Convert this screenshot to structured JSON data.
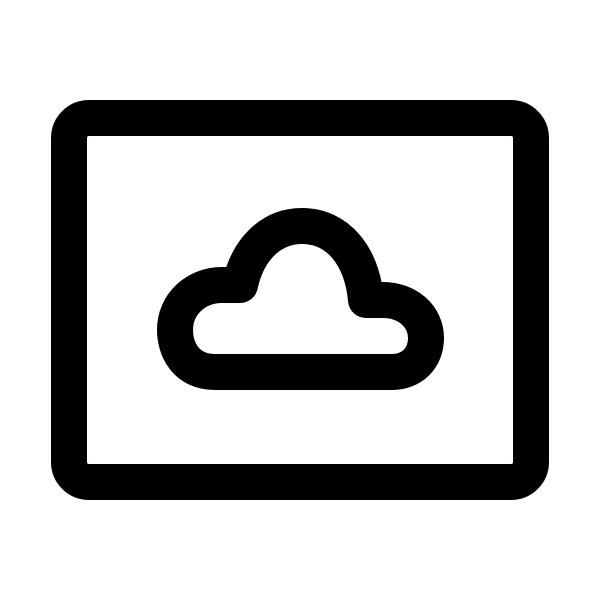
{
  "icon": {
    "name": "cloud-in-frame-icon",
    "stroke_color": "#000000",
    "background_color": "#ffffff"
  }
}
